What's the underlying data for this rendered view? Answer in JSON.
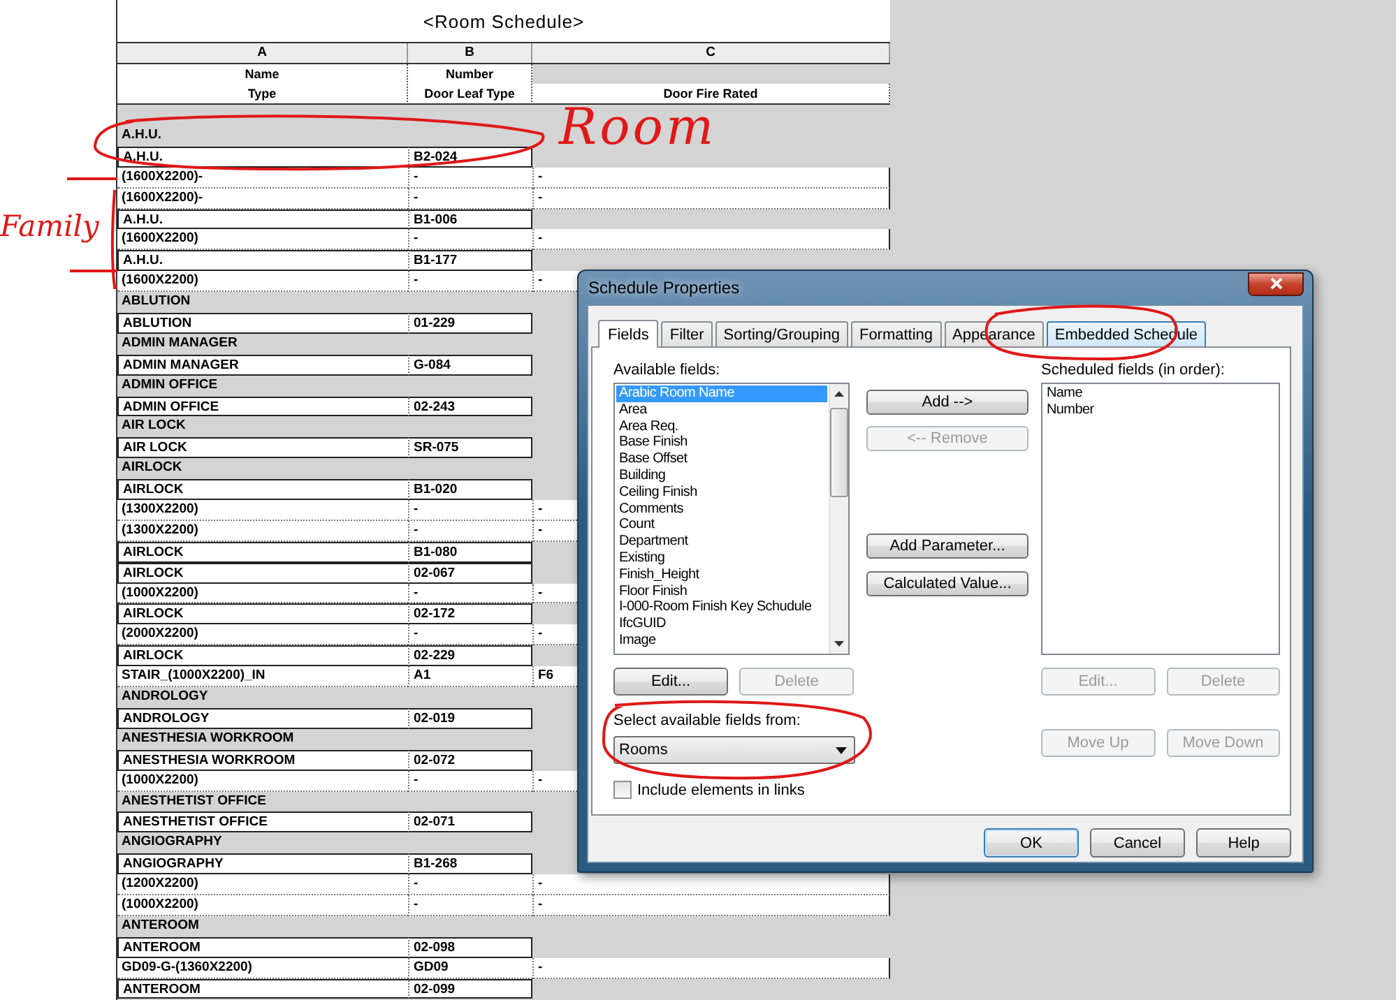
{
  "schedule": {
    "title": "<Room Schedule>",
    "column_letters": [
      "A",
      "B",
      "C"
    ],
    "header_rows": [
      {
        "cells": [
          "Name",
          "Number"
        ]
      },
      {
        "cells": [
          "Type",
          "Door Leaf Type",
          "Door Fire Rated"
        ]
      }
    ],
    "rows": [
      {
        "kind": "group",
        "cells": [
          "A.H.U."
        ]
      },
      {
        "kind": "room",
        "cells": [
          "A.H.U.",
          "B2-024"
        ]
      },
      {
        "kind": "door",
        "cells": [
          "(1600X2200)-",
          "-",
          "-"
        ]
      },
      {
        "kind": "door",
        "cells": [
          "(1600X2200)-",
          "-",
          "-"
        ]
      },
      {
        "kind": "room",
        "cells": [
          "A.H.U.",
          "B1-006"
        ]
      },
      {
        "kind": "door",
        "cells": [
          "(1600X2200)",
          "-",
          "-"
        ]
      },
      {
        "kind": "room",
        "cells": [
          "A.H.U.",
          "B1-177"
        ]
      },
      {
        "kind": "door",
        "cells": [
          "(1600X2200)",
          "-",
          "-"
        ]
      },
      {
        "kind": "group",
        "cells": [
          "ABLUTION"
        ]
      },
      {
        "kind": "room",
        "cells": [
          "ABLUTION",
          "01-229"
        ]
      },
      {
        "kind": "group",
        "cells": [
          "ADMIN MANAGER"
        ]
      },
      {
        "kind": "room",
        "cells": [
          "ADMIN MANAGER",
          "G-084"
        ]
      },
      {
        "kind": "group",
        "cells": [
          "ADMIN OFFICE"
        ]
      },
      {
        "kind": "room",
        "cells": [
          "ADMIN OFFICE",
          "02-243"
        ]
      },
      {
        "kind": "group",
        "cells": [
          "AIR LOCK"
        ]
      },
      {
        "kind": "room",
        "cells": [
          "AIR LOCK",
          "SR-075"
        ]
      },
      {
        "kind": "group",
        "cells": [
          "AIRLOCK"
        ]
      },
      {
        "kind": "room",
        "cells": [
          "AIRLOCK",
          "B1-020"
        ]
      },
      {
        "kind": "door",
        "cells": [
          "(1300X2200)",
          "-",
          "-"
        ]
      },
      {
        "kind": "door",
        "cells": [
          "(1300X2200)",
          "-",
          "-"
        ]
      },
      {
        "kind": "room",
        "cells": [
          "AIRLOCK",
          "B1-080"
        ]
      },
      {
        "kind": "room",
        "cells": [
          "AIRLOCK",
          "02-067"
        ]
      },
      {
        "kind": "door",
        "cells": [
          "(1000X2200)",
          "-",
          "-"
        ]
      },
      {
        "kind": "room",
        "cells": [
          "AIRLOCK",
          "02-172"
        ]
      },
      {
        "kind": "door",
        "cells": [
          "(2000X2200)",
          "-",
          "-"
        ]
      },
      {
        "kind": "room",
        "cells": [
          "AIRLOCK",
          "02-229"
        ]
      },
      {
        "kind": "door",
        "cells": [
          "STAIR_(1000X2200)_IN",
          "A1",
          "F6"
        ]
      },
      {
        "kind": "group",
        "cells": [
          "ANDROLOGY"
        ]
      },
      {
        "kind": "room",
        "cells": [
          "ANDROLOGY",
          "02-019"
        ]
      },
      {
        "kind": "group",
        "cells": [
          "ANESTHESIA WORKROOM"
        ]
      },
      {
        "kind": "room",
        "cells": [
          "ANESTHESIA WORKROOM",
          "02-072"
        ]
      },
      {
        "kind": "door",
        "cells": [
          "(1000X2200)",
          "-",
          "-"
        ]
      },
      {
        "kind": "group",
        "cells": [
          "ANESTHETIST OFFICE"
        ]
      },
      {
        "kind": "room",
        "cells": [
          "ANESTHETIST OFFICE",
          "02-071"
        ]
      },
      {
        "kind": "group",
        "cells": [
          "ANGIOGRAPHY"
        ]
      },
      {
        "kind": "room",
        "cells": [
          "ANGIOGRAPHY",
          "B1-268"
        ]
      },
      {
        "kind": "door",
        "cells": [
          "(1200X2200)",
          "-",
          "-"
        ]
      },
      {
        "kind": "door",
        "cells": [
          "(1000X2200)",
          "-",
          "-"
        ]
      },
      {
        "kind": "group",
        "cells": [
          "ANTEROOM"
        ]
      },
      {
        "kind": "room",
        "cells": [
          "ANTEROOM",
          "02-098"
        ]
      },
      {
        "kind": "door",
        "cells": [
          "GD09-G-(1360X2200)",
          "GD09",
          "-"
        ]
      },
      {
        "kind": "room",
        "cells": [
          "ANTEROOM",
          "02-099"
        ]
      }
    ]
  },
  "annotations": [
    {
      "text": "Room"
    },
    {
      "text": "Family"
    }
  ],
  "dialog": {
    "title": "Schedule Properties",
    "tabs": [
      {
        "label": "Fields",
        "selected": true,
        "highlighted": false
      },
      {
        "label": "Filter",
        "selected": false,
        "highlighted": false
      },
      {
        "label": "Sorting/Grouping",
        "selected": false,
        "highlighted": false
      },
      {
        "label": "Formatting",
        "selected": false,
        "highlighted": false
      },
      {
        "label": "Appearance",
        "selected": false,
        "highlighted": false
      },
      {
        "label": "Embedded Schedule",
        "selected": false,
        "highlighted": true
      }
    ],
    "available_label": "Available fields:",
    "available_fields": [
      {
        "label": "Arabic Room Name",
        "selected": true
      },
      {
        "label": "Area",
        "selected": false
      },
      {
        "label": "Area Req.",
        "selected": false
      },
      {
        "label": "Base Finish",
        "selected": false
      },
      {
        "label": "Base Offset",
        "selected": false
      },
      {
        "label": "Building",
        "selected": false
      },
      {
        "label": "Ceiling Finish",
        "selected": false
      },
      {
        "label": "Comments",
        "selected": false
      },
      {
        "label": "Count",
        "selected": false
      },
      {
        "label": "Department",
        "selected": false
      },
      {
        "label": "Existing",
        "selected": false
      },
      {
        "label": "Finish_Height",
        "selected": false
      },
      {
        "label": "Floor Finish",
        "selected": false
      },
      {
        "label": "I-000-Room Finish Key Schudule",
        "selected": false
      },
      {
        "label": "IfcGUID",
        "selected": false
      },
      {
        "label": "Image",
        "selected": false
      }
    ],
    "middle_buttons": [
      {
        "label": "Add -->",
        "disabled": false
      },
      {
        "label": "<-- Remove",
        "disabled": true
      },
      {
        "label": "Add Parameter...",
        "disabled": false
      },
      {
        "label": "Calculated Value...",
        "disabled": false
      }
    ],
    "scheduled_label": "Scheduled fields (in order):",
    "scheduled_fields": [
      "Name",
      "Number"
    ],
    "left_buttons": [
      {
        "label": "Edit...",
        "disabled": false
      },
      {
        "label": "Delete",
        "disabled": true
      }
    ],
    "right_buttons": [
      {
        "label": "Edit...",
        "disabled": true
      },
      {
        "label": "Delete",
        "disabled": true
      }
    ],
    "move_buttons": [
      {
        "label": "Move Up",
        "disabled": true
      },
      {
        "label": "Move Down",
        "disabled": true
      }
    ],
    "source_label": "Select available fields from:",
    "source": {
      "value": "Rooms"
    },
    "include_links": {
      "label": "Include elements in links",
      "checked": false
    },
    "footer_buttons": [
      {
        "label": "OK",
        "default": true
      },
      {
        "label": "Cancel",
        "default": false
      },
      {
        "label": "Help",
        "default": false
      }
    ]
  }
}
